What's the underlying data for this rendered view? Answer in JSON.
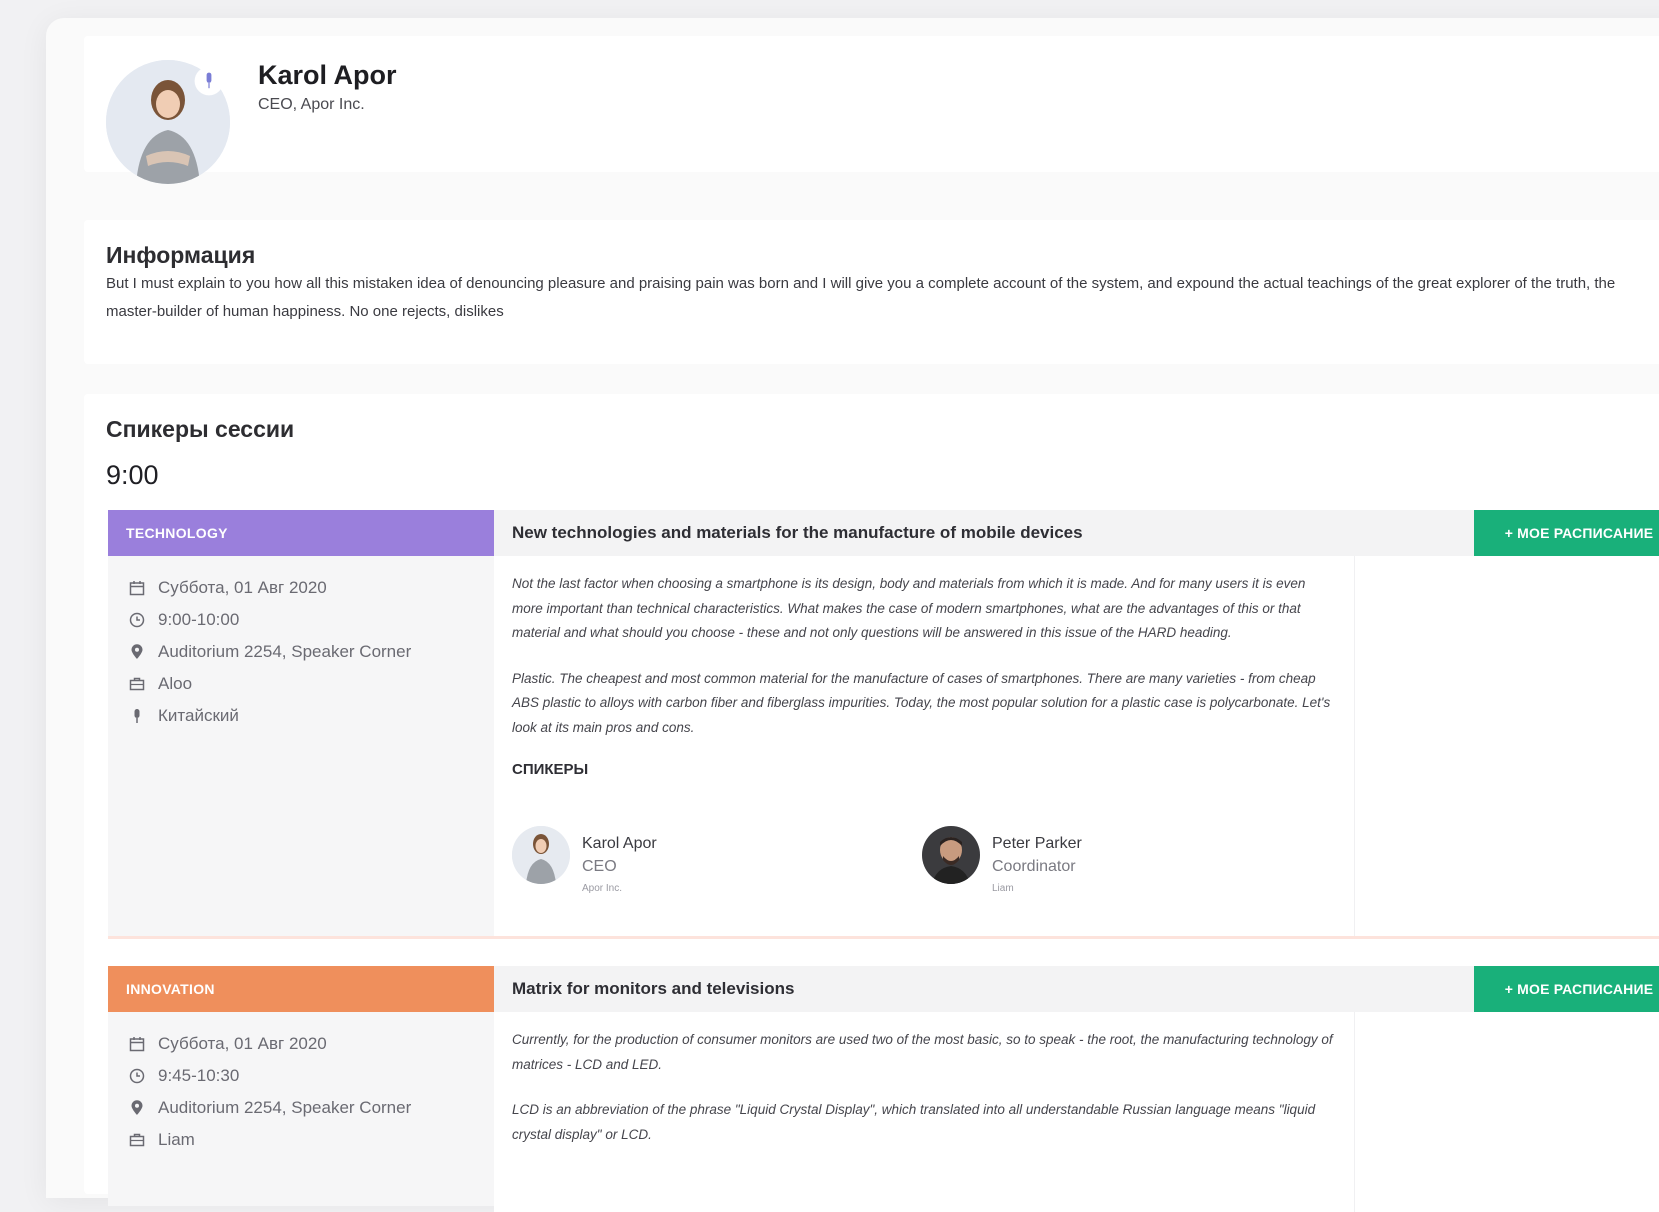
{
  "profile": {
    "name": "Karol Apor",
    "role": "CEO, Apor Inc."
  },
  "info": {
    "title": "Информация",
    "text": "But I must explain to you how all this mistaken idea of denouncing pleasure and praising pain was born and I will give you a complete account of the system, and expound the actual teachings of the great explorer of the truth, the master-builder of human happiness. No one rejects, dislikes"
  },
  "speakers_section": {
    "title": "Спикеры сессии",
    "time": "9:00"
  },
  "sessions": [
    {
      "category": "TECHNOLOGY",
      "category_color": "#9a7fdc",
      "date": "Суббота, 01 Авг 2020",
      "time": "9:00-10:00",
      "location": "Auditorium 2254, Speaker Corner",
      "org": "Aloo",
      "language": "Китайский",
      "title": "New technologies and materials for the manufacture of mobile devices",
      "button": "+ МОЕ РАСПИСАНИЕ",
      "desc1": "Not the last factor when choosing a smartphone is its design, body and materials from which it is made. And for many users it is even more important than technical characteristics. What makes the case of modern smartphones, what are the advantages of this or that material and what should you choose - these and not only questions will be answered in this issue of the HARD heading.",
      "desc2": "Plastic. The cheapest and most common material for the manufacture of cases of smartphones. There are many varieties - from cheap ABS plastic to alloys with carbon fiber and fiberglass impurities. Today, the most popular solution for a plastic case is polycarbonate. Let's look at its main pros and cons.",
      "speakers_label": "СПИКЕРЫ",
      "speakers": [
        {
          "name": "Karol Apor",
          "role": "CEO",
          "company": "Apor Inc."
        },
        {
          "name": "Peter Parker",
          "role": "Coordinator",
          "company": "Liam"
        }
      ]
    },
    {
      "category": "INNOVATION",
      "category_color": "#ef8f5c",
      "date": "Суббота, 01 Авг 2020",
      "time": "9:45-10:30",
      "location": "Auditorium 2254, Speaker Corner",
      "org": "Liam",
      "title": "Matrix for monitors and televisions",
      "button": "+ МОЕ РАСПИСАНИЕ",
      "desc1": "Currently, for the production of consumer monitors are used two of the most basic, so to speak - the root, the manufacturing technology of matrices - LCD and LED.",
      "desc2": "LCD is an abbreviation of the phrase \"Liquid Crystal Display\", which translated into all understandable Russian language means \"liquid crystal display\" or LCD."
    }
  ],
  "colors": {
    "accent_green": "#19b07a",
    "technology_purple": "#9a7fdc",
    "innovation_orange": "#ef8f5c"
  }
}
